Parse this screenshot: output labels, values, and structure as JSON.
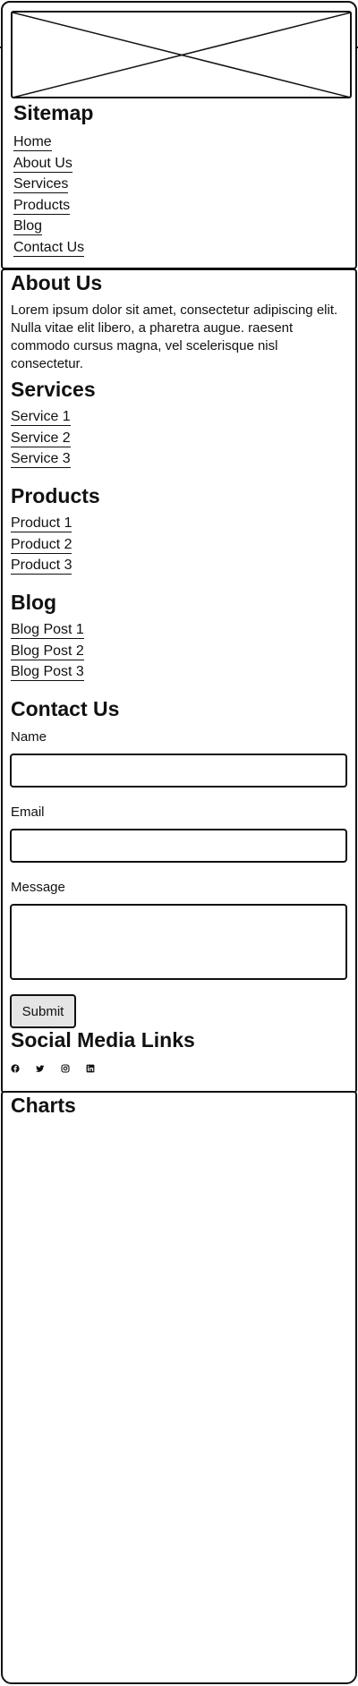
{
  "sitemap": {
    "title": "Sitemap",
    "links": [
      "Home",
      "About Us",
      "Services",
      "Products",
      "Blog",
      "Contact Us"
    ]
  },
  "about": {
    "title": "About Us",
    "text": "Lorem ipsum dolor sit amet, consectetur adipiscing elit. Nulla vitae elit libero, a pharetra augue. raesent commodo cursus magna, vel scelerisque nisl consectetur."
  },
  "services": {
    "title": "Services",
    "links": [
      "Service 1",
      "Service 2",
      "Service 3"
    ]
  },
  "products": {
    "title": "Products",
    "links": [
      "Product 1",
      "Product 2",
      "Product 3"
    ]
  },
  "blog": {
    "title": "Blog",
    "links": [
      "Blog Post 1",
      "Blog Post 2",
      "Blog Post 3"
    ]
  },
  "contact": {
    "title": "Contact Us",
    "name_label": "Name",
    "email_label": "Email",
    "message_label": "Message",
    "submit_label": "Submit"
  },
  "social": {
    "title": "Social Media Links",
    "icons": [
      "facebook-icon",
      "twitter-icon",
      "instagram-icon",
      "linkedin-icon"
    ]
  },
  "charts": {
    "title": "Charts"
  }
}
